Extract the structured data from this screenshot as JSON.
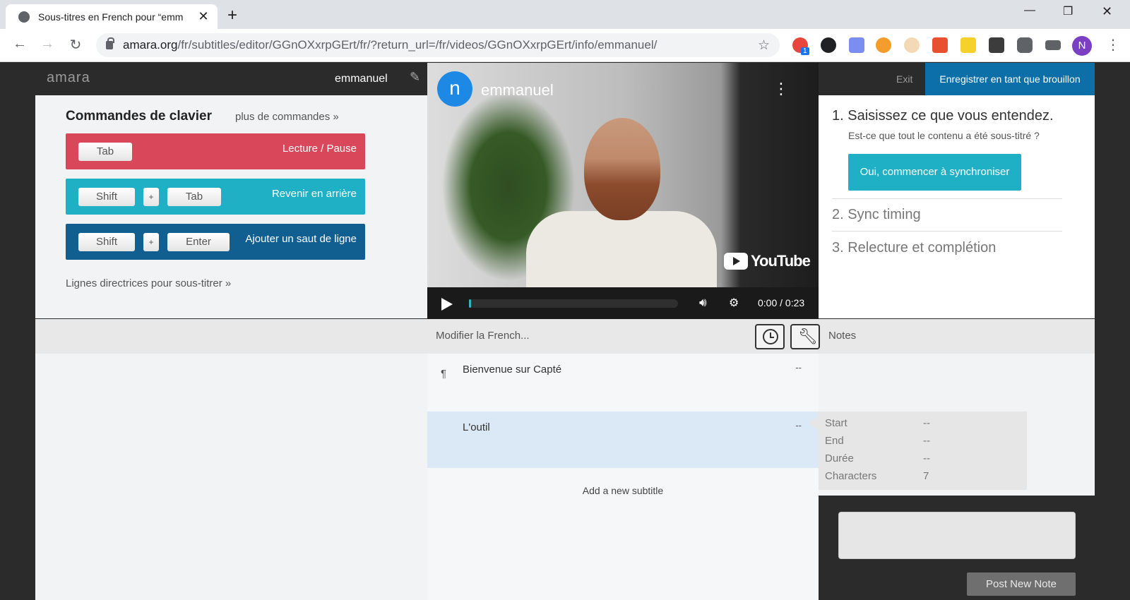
{
  "browser": {
    "tab_title": "Sous-titres en French pour “emm",
    "tab_close": "✕",
    "new_tab": "+",
    "url_host": "amara.org",
    "url_path": "/fr/subtitles/editor/GGnOXxrpGErt/fr/?return_url=/fr/videos/GGnOXxrpGErt/info/emmanuel/",
    "ext_badge": "1",
    "profile_initial": "N"
  },
  "app": {
    "logo": "amara",
    "video_title": "emmanuel",
    "exit_label": "Exit",
    "save_draft_label": "Enregistrer en tant que brouillon"
  },
  "keyboard": {
    "title": "Commandes de clavier",
    "more_link": "plus de commandes »",
    "rows": [
      {
        "keys": [
          "Tab"
        ],
        "action": "Lecture / Pause",
        "color": "#d9475a"
      },
      {
        "keys": [
          "Shift",
          "Tab"
        ],
        "action": "Revenir en arrière",
        "color": "#1fb0c6"
      },
      {
        "keys": [
          "Shift",
          "Enter"
        ],
        "action": "Ajouter un saut de ligne",
        "color": "#115f91"
      }
    ],
    "plus": "+",
    "guidelines_link": "Lignes directrices pour sous-titrer »"
  },
  "video": {
    "channel_initial": "n",
    "channel_name": "emmanuel",
    "youtube_word": "YouTube",
    "time": "0:00 / 0:23",
    "progress": 0.01
  },
  "steps": {
    "step1": "1. Saisissez ce que vous entendez.",
    "step1_question": "Est-ce que tout le contenu a été sous-titré ?",
    "sync_button": "Oui, commencer à synchroniser",
    "step2": "2. Sync timing",
    "step3": "3. Relecture et complétion"
  },
  "editor": {
    "edit_label": "Modifier la French...",
    "notes_label": "Notes",
    "subtitles": [
      {
        "text": "Bienvenue sur Capté",
        "time": "--"
      },
      {
        "text": "L'outil",
        "time": "--"
      }
    ],
    "pilcrow": "¶",
    "add_subtitle": "Add a new subtitle"
  },
  "info": {
    "start_label": "Start",
    "start_value": "--",
    "end_label": "End",
    "end_value": "--",
    "duration_label": "Durée",
    "duration_value": "--",
    "chars_label": "Characters",
    "chars_value": "7"
  },
  "notes": {
    "post_button": "Post New Note"
  }
}
